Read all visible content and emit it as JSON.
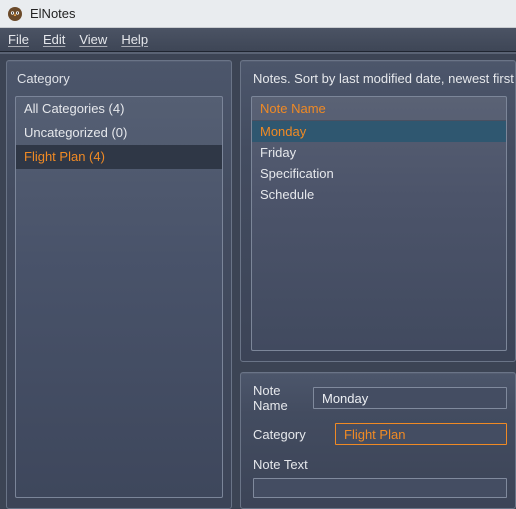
{
  "window": {
    "title": "ElNotes"
  },
  "menu": {
    "file": "File",
    "edit": "Edit",
    "view": "View",
    "help": "Help"
  },
  "sidebar": {
    "title": "Category",
    "items": [
      {
        "label": "All Categories (4)",
        "selected": false
      },
      {
        "label": "Uncategorized (0)",
        "selected": false
      },
      {
        "label": "Flight Plan (4)",
        "selected": true
      }
    ]
  },
  "notes": {
    "hint": "Notes. Sort by last modified date, newest first",
    "header": "Note Name",
    "rows": [
      {
        "label": "Monday",
        "selected": true
      },
      {
        "label": "Friday",
        "selected": false
      },
      {
        "label": "Specification",
        "selected": false
      },
      {
        "label": "Schedule",
        "selected": false
      }
    ]
  },
  "detail": {
    "name_label": "Note Name",
    "name_value": "Monday",
    "category_label": "Category",
    "category_value": "Flight Plan",
    "text_label": "Note Text"
  }
}
